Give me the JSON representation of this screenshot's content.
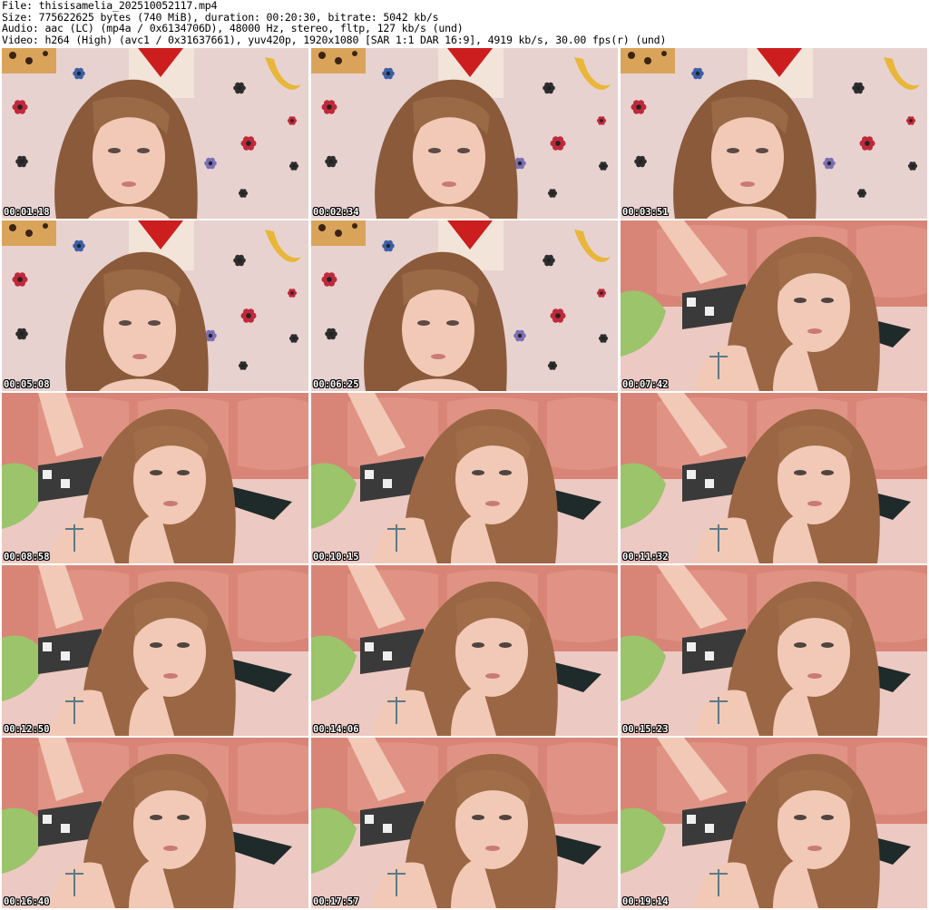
{
  "header": {
    "lines": [
      "File: thisisamelia_202510052117.mp4",
      "Size: 775622625 bytes (740 MiB), duration: 00:20:30, bitrate: 5042 kb/s",
      "Audio: aac (LC) (mp4a / 0x6134706D), 48000 Hz, stereo, fltp, 127 kb/s (und)",
      "Video: h264 (High) (avc1 / 0x31637661), yuv420p, 1920x1080 [SAR 1:1 DAR 16:9], 4919 kb/s, 30.00 fps(r) (und)"
    ]
  },
  "thumbnails": [
    {
      "timestamp": "00:01:18",
      "scene": "wall"
    },
    {
      "timestamp": "00:02:34",
      "scene": "wall"
    },
    {
      "timestamp": "00:03:51",
      "scene": "wall"
    },
    {
      "timestamp": "00:05:08",
      "scene": "wall"
    },
    {
      "timestamp": "00:06:25",
      "scene": "wall"
    },
    {
      "timestamp": "00:07:42",
      "scene": "bed"
    },
    {
      "timestamp": "00:08:58",
      "scene": "bed"
    },
    {
      "timestamp": "00:10:15",
      "scene": "bed"
    },
    {
      "timestamp": "00:11:32",
      "scene": "bed"
    },
    {
      "timestamp": "00:12:50",
      "scene": "bed"
    },
    {
      "timestamp": "00:14:06",
      "scene": "bed"
    },
    {
      "timestamp": "00:15:23",
      "scene": "bed"
    },
    {
      "timestamp": "00:16:40",
      "scene": "bed"
    },
    {
      "timestamp": "00:17:57",
      "scene": "bed"
    },
    {
      "timestamp": "00:19:14",
      "scene": "bed"
    }
  ],
  "colors": {
    "background": "#ffffff",
    "header_text": "#000000",
    "timestamp_text": "#ffffff",
    "timestamp_outline": "#000000",
    "wall_pink": "#e8d2d0",
    "hair_brown": "#8a5a3a",
    "skin": "#f1c9b6",
    "headboard": "#d88577",
    "blanket": "#ecc9c2"
  }
}
